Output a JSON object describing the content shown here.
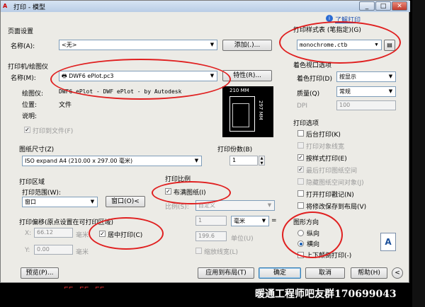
{
  "window": {
    "title": "打印 - 模型",
    "help_link": "了解打印",
    "min_label": "_",
    "max_label": "□",
    "close_label": "✕"
  },
  "page_setup": {
    "group": "页面设置",
    "name_label": "名称(A):",
    "name_value": "<无>",
    "add_button": "添加(.)..."
  },
  "plotter": {
    "group": "打印机/绘图仪",
    "name_label": "名称(M):",
    "name_value": "DWF6 ePlot.pc3",
    "properties_button": "特性(R)...",
    "plotter_label": "绘图仪:",
    "plotter_value": "DWF6 ePlot - DWF ePlot - by Autodesk",
    "location_label": "位置:",
    "location_value": "文件",
    "description_label": "说明:",
    "print_to_file_label": "打印到文件(F)",
    "preview_width": "210 MM",
    "preview_height": "297 MM"
  },
  "paper_size": {
    "group": "图纸尺寸(Z)",
    "value": "ISO expand A4 (210.00 x 297.00 毫米)"
  },
  "copies": {
    "group": "打印份数(B)",
    "value": "1"
  },
  "plot_area": {
    "group": "打印区域",
    "range_label": "打印范围(W):",
    "range_value": "窗口",
    "window_button": "窗口(O)<"
  },
  "plot_offset": {
    "group": "打印偏移(原点设置在可打印区域)",
    "x_label": "X:",
    "x_value": "66.12",
    "x_unit": "毫米",
    "y_label": "Y:",
    "y_value": "0.00",
    "y_unit": "毫米",
    "center_label": "居中打印(C)"
  },
  "plot_scale": {
    "group": "打印比例",
    "fit_label": "布满图纸(I)",
    "scale_label": "比例(S):",
    "scale_value": "自定义",
    "num_value": "1",
    "unit_value": "毫米",
    "equals": "=",
    "den_value": "199.6",
    "unit_label": "单位(U)",
    "lineweights_label": "缩放线宽(L)"
  },
  "plot_style": {
    "group": "打印样式表 (笔指定)(G)",
    "value": "monochrome.ctb"
  },
  "shaded": {
    "group": "着色视口选项",
    "shade_label": "着色打印(D)",
    "shade_value": "按显示",
    "quality_label": "质量(Q)",
    "quality_value": "常规",
    "dpi_label": "DPI",
    "dpi_value": "100"
  },
  "plot_options": {
    "group": "打印选项",
    "items": [
      {
        "label": "后台打印(K)",
        "checked": "",
        "disabled": false
      },
      {
        "label": "打印对象线宽",
        "checked": "",
        "disabled": true
      },
      {
        "label": "按样式打印(E)",
        "checked": "✓",
        "disabled": false
      },
      {
        "label": "最后打印图纸空间",
        "checked": "✓",
        "disabled": true
      },
      {
        "label": "隐藏图纸空间对象(J)",
        "checked": "",
        "disabled": true
      },
      {
        "label": "打开打印戳记(N)",
        "checked": "",
        "disabled": false
      },
      {
        "label": "将修改保存到布局(V)",
        "checked": "",
        "disabled": false
      }
    ]
  },
  "orientation": {
    "group": "图形方向",
    "portrait_label": "纵向",
    "landscape_label": "横向",
    "upside_label": "上下颠倒打印(-)",
    "icon_letter": "A"
  },
  "footer": {
    "preview_button": "预览(P)...",
    "apply_button": "应用到布局(T)",
    "ok_button": "确定",
    "cancel_button": "取消",
    "help_button": "帮助(H)",
    "collapse_label": "<"
  },
  "background": {
    "watermark": "暖通工程师吧友群170699043"
  }
}
